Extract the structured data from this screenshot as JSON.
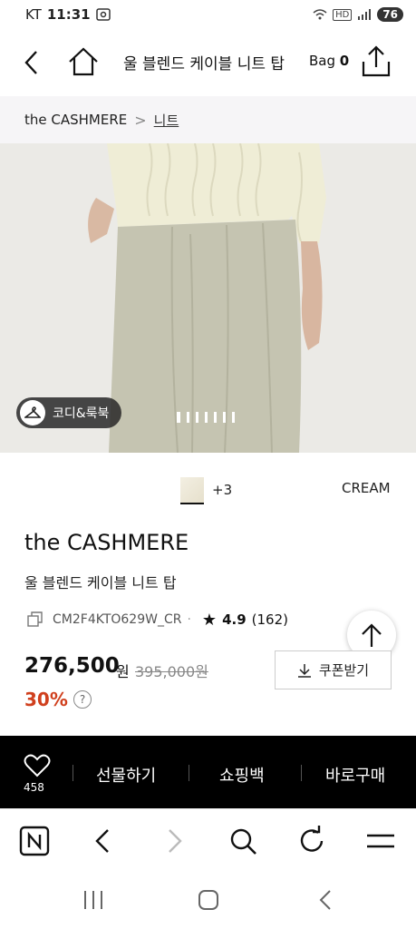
{
  "status_bar": {
    "carrier": "KT",
    "time": "11:31",
    "network": "HD",
    "battery": "76"
  },
  "header": {
    "title": "울 블렌드 케이블 니트 탑",
    "bag_label": "Bag",
    "bag_count": "0"
  },
  "breadcrumb": {
    "brand": "the CASHMERE",
    "separator": ">",
    "category": "니트"
  },
  "hero": {
    "coordi_label": "코디&룩북",
    "image_count": 7,
    "active_index": 0
  },
  "color_selector": {
    "more_label": "+3",
    "selected_color": "CREAM"
  },
  "product": {
    "brand": "the CASHMERE",
    "name": "울 블렌드 케이블 니트 탑",
    "code": "CM2F4KTO629W_CR",
    "rating": "4.9",
    "review_count": "(162)",
    "price": "276,500",
    "currency": "원",
    "original_price": "395,000원",
    "discount": "30%",
    "help_mark": "?",
    "coupon_label": "쿠폰받기"
  },
  "action_bar": {
    "like_count": "458",
    "gift_label": "선물하기",
    "cart_label": "쇼핑백",
    "buy_label": "바로구매"
  },
  "colors": {
    "discount_red": "#d0401e",
    "action_bar_bg": "#000000",
    "breadcrumb_bg": "#f6f5f7"
  }
}
